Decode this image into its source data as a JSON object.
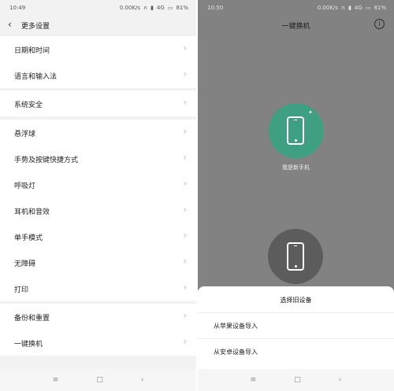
{
  "left_screen": {
    "statusbar": {
      "time": "10:49",
      "speed": "0.00K/s",
      "network": "4G",
      "battery": "81%"
    },
    "title": "更多设置",
    "groups": [
      [
        "日期和时间",
        "语言和输入法"
      ],
      [
        "系统安全"
      ],
      [
        "悬浮球",
        "手势及按键快捷方式",
        "呼吸灯",
        "耳机和音效",
        "单手模式",
        "无障碍",
        "打印"
      ],
      [
        "备份和重置",
        "一键换机"
      ]
    ],
    "navbar": {
      "menu": "≡",
      "home": "□",
      "back": "‹"
    }
  },
  "right_screen": {
    "statusbar": {
      "time": "10:50",
      "speed": "0.00K/s",
      "network": "4G",
      "battery": "81%"
    },
    "title": "一键换机",
    "info_icon": "i",
    "new_phone_label": "我是新手机",
    "sheet": {
      "title": "选择旧设备",
      "options": [
        "从苹果设备导入",
        "从安卓设备导入"
      ]
    },
    "navbar": {
      "menu": "≡",
      "home": "□",
      "back": "‹"
    }
  },
  "colors": {
    "accent_green": "#3f9f83",
    "old_phone_gray": "#5c5c5c",
    "overlay_gray": "#828282"
  }
}
